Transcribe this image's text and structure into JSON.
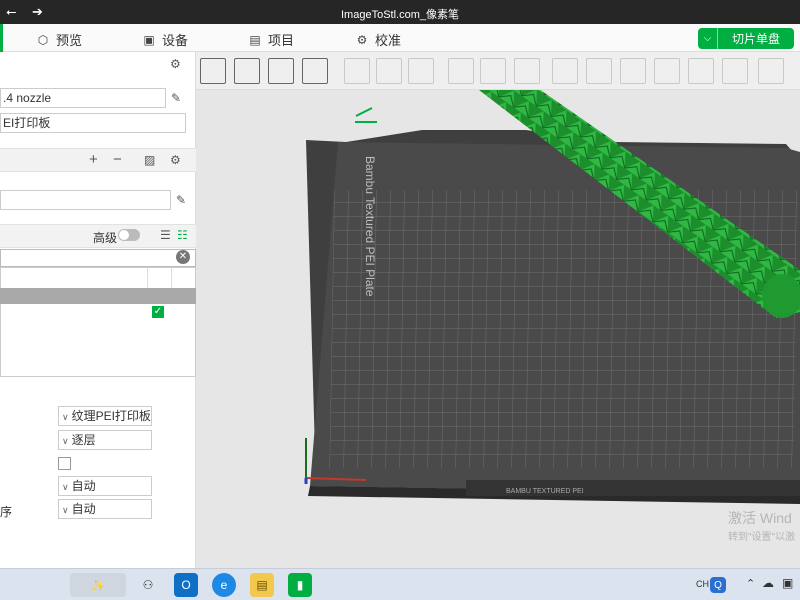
{
  "titlebar": {
    "title": "ImageToStl.com_像素笔"
  },
  "menu": [
    {
      "label": "预览",
      "icon": "cube-icon"
    },
    {
      "label": "设备",
      "icon": "device-icon"
    },
    {
      "label": "项目",
      "icon": "project-icon"
    },
    {
      "label": "校准",
      "icon": "calibrate-icon"
    }
  ],
  "slice_button": {
    "label": "切片单盘"
  },
  "left_panel": {
    "printer_nozzle": ".4 nozzle",
    "plate_type_top": "EI打印板",
    "advanced_label": "高级",
    "plate_type_label": "纹理PEI打印板",
    "sequence_label": "逐层",
    "auto_label_1": "自动",
    "auto_label_2": "自动",
    "side_char": "序"
  },
  "viewport": {
    "plate_name": "Bambu Textured PEI Plate",
    "plate_bottom_label": "BAMBU TEXTURED PEI"
  },
  "watermark": {
    "line1": "激活 Wind",
    "line2": "转到\"设置\"以激"
  },
  "taskbar": {
    "lang": "CH"
  },
  "colors": {
    "accent": "#00ae42",
    "plate": "#3f3f3f",
    "model": "#1c8e2c"
  }
}
